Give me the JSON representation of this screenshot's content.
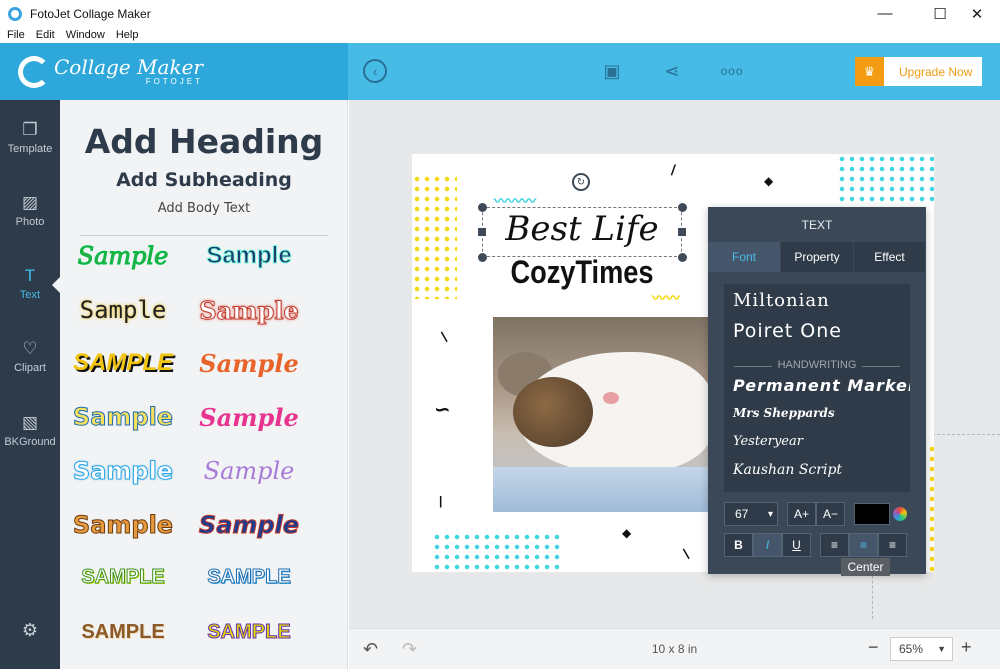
{
  "window": {
    "title": "FotoJet Collage Maker",
    "min_glyph": "—",
    "max_glyph": "☐",
    "close_glyph": "✕"
  },
  "menu": {
    "items": [
      "File",
      "Edit",
      "Window",
      "Help"
    ]
  },
  "logo": {
    "main": "Collage Maker",
    "sub": "FOTOJET"
  },
  "toolbar": {
    "back_glyph": "‹",
    "save_glyph": "▣",
    "share_glyph": "⋖",
    "more_glyph": "ooo",
    "upgrade_label": "Upgrade Now",
    "crown_glyph": "♛"
  },
  "sidebar": {
    "items": [
      {
        "label": "Template",
        "glyph": "❐"
      },
      {
        "label": "Photo",
        "glyph": "▨"
      },
      {
        "label": "Text",
        "glyph": "T"
      },
      {
        "label": "Clipart",
        "glyph": "♡"
      },
      {
        "label": "BKGround",
        "glyph": "▧"
      }
    ],
    "settings_glyph": "⚙"
  },
  "text_panel": {
    "heading": "Add Heading",
    "subheading": "Add Subheading",
    "body": "Add Body Text",
    "samples": [
      "Sample",
      "Sample",
      "Sample",
      "Sample",
      "SAMPLE",
      "Sample",
      "Sample",
      "Sample",
      "Sample",
      "Sample",
      "Sample",
      "Sample",
      "SAMPLE",
      "SAMPLE",
      "SAMPLE",
      "SAMPLE"
    ]
  },
  "canvas": {
    "text1": "Best Life",
    "text2": "CozyTimes",
    "rotate_glyph": "↻",
    "colors": {
      "yellow": "#f5d90a",
      "cyan": "#3fd6e0"
    }
  },
  "format_panel": {
    "title": "TEXT",
    "tabs": [
      "Font",
      "Property",
      "Effect"
    ],
    "active_tab": "Font",
    "fonts_top": [
      "Miltonian",
      "Poiret One"
    ],
    "section_label": "HANDWRITING",
    "fonts_handwriting": [
      "Permanent Marker",
      "Mrs Sheppards",
      "Yesteryear",
      "Kaushan Script"
    ],
    "font_size": "67",
    "increase_label": "A+",
    "decrease_label": "A−",
    "text_color": "#000000",
    "bold_label": "B",
    "italic_label": "I",
    "underline_label": "U",
    "align_left_glyph": "≡",
    "align_center_glyph": "≡",
    "align_right_glyph": "≡",
    "tooltip": "Center"
  },
  "bottom": {
    "canvas_size": "10 x 8 in",
    "zoom": "65%",
    "undo_glyph": "↶",
    "redo_glyph": "↷",
    "zoom_out_glyph": "−",
    "zoom_in_glyph": "+"
  }
}
